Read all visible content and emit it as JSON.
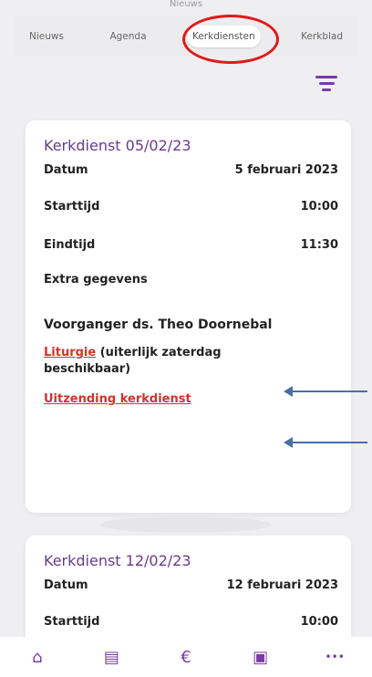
{
  "header": {
    "title": "Nieuws"
  },
  "tabs": [
    {
      "label": "Nieuws"
    },
    {
      "label": "Agenda"
    },
    {
      "label": "Kerkdiensten"
    },
    {
      "label": "Kerkblad"
    }
  ],
  "annotation": {
    "circle_color": "#e01a1a",
    "arrow_color": "#4a6fa5"
  },
  "services": [
    {
      "title": "Kerkdienst 05/02/23",
      "rows": [
        {
          "label": "Datum",
          "value": "5 februari 2023"
        },
        {
          "label": "Starttijd",
          "value": "10:00"
        },
        {
          "label": "Eindtijd",
          "value": "11:30"
        }
      ],
      "extra_label": "Extra gegevens",
      "preacher": "Voorganger ds. Theo Doornebal",
      "liturgie_link": "Liturgie",
      "liturgie_note": " (uiterlijk zaterdag beschikbaar)",
      "broadcast_link": "Uitzending kerkdienst"
    },
    {
      "title": "Kerkdienst 12/02/23",
      "rows": [
        {
          "label": "Datum",
          "value": "12 februari 2023"
        },
        {
          "label": "Starttijd",
          "value": "10:00"
        }
      ]
    }
  ],
  "bottom_nav": [
    {
      "icon": "home-icon",
      "glyph": "⌂"
    },
    {
      "icon": "document-icon",
      "glyph": "▤"
    },
    {
      "icon": "euro-icon",
      "glyph": "€"
    },
    {
      "icon": "contact-card-icon",
      "glyph": "▣"
    },
    {
      "icon": "more-icon",
      "glyph": "•••"
    }
  ]
}
